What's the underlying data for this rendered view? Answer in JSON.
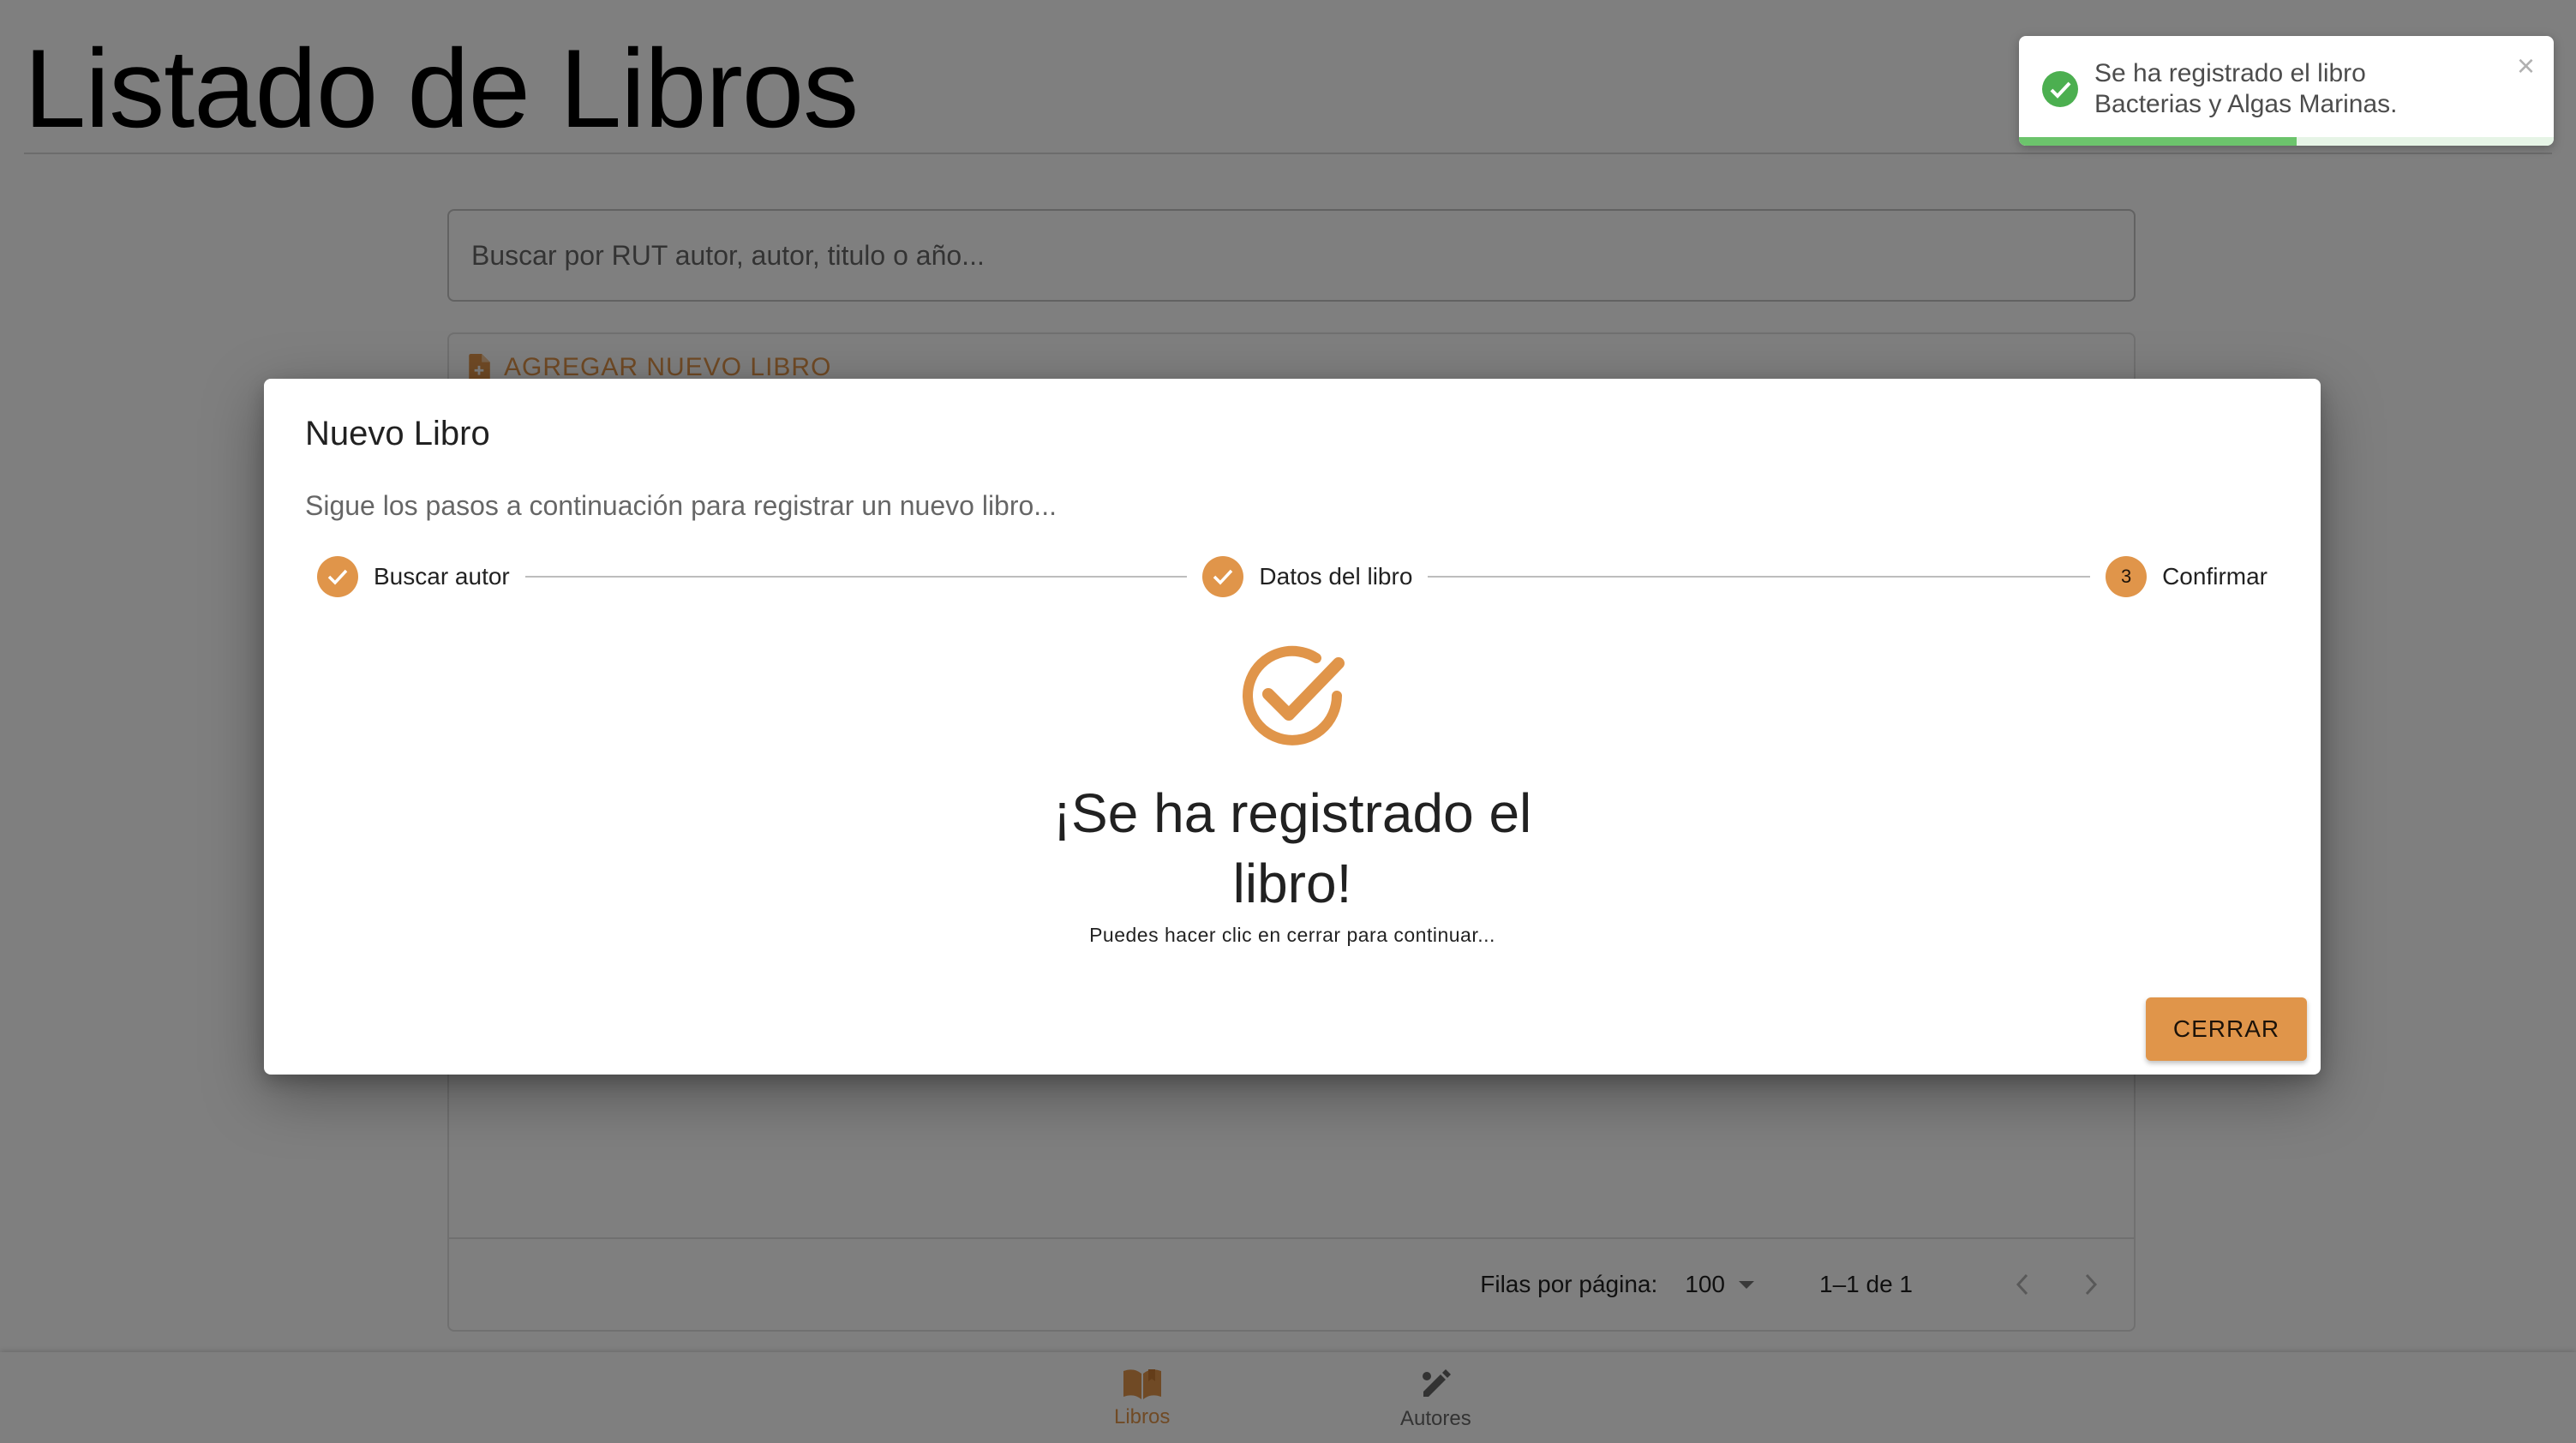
{
  "page": {
    "title": "Listado de Libros",
    "search_placeholder": "Buscar por RUT autor, autor, titulo o año...",
    "add_book_label": "AGREGAR NUEVO LIBRO",
    "pagination": {
      "rows_per_page_label": "Filas por página:",
      "rows_per_page_value": "100",
      "range_label": "1–1 de 1"
    }
  },
  "bottom_nav": {
    "items": [
      {
        "label": "Libros",
        "icon": "book-open-icon",
        "active": true
      },
      {
        "label": "Autores",
        "icon": "pen-icon",
        "active": false
      }
    ]
  },
  "dialog": {
    "title": "Nuevo Libro",
    "description": "Sigue los pasos a continuación para registrar un nuevo libro...",
    "steps": [
      {
        "label": "Buscar autor",
        "state": "completed"
      },
      {
        "label": "Datos del libro",
        "state": "completed"
      },
      {
        "label": "Confirmar",
        "state": "active",
        "number": "3"
      }
    ],
    "success_title": "¡Se ha registrado el libro!",
    "success_subtitle": "Puedes hacer clic en cerrar para continuar...",
    "close_label": "CERRAR"
  },
  "toast": {
    "line1": "Se ha registrado el libro",
    "line2": "Bacterias y Algas Marinas.",
    "progress": 0.52
  },
  "colors": {
    "accent": "#e0954a",
    "success": "#4caf50",
    "backdrop": "rgba(0,0,0,0.5)"
  }
}
